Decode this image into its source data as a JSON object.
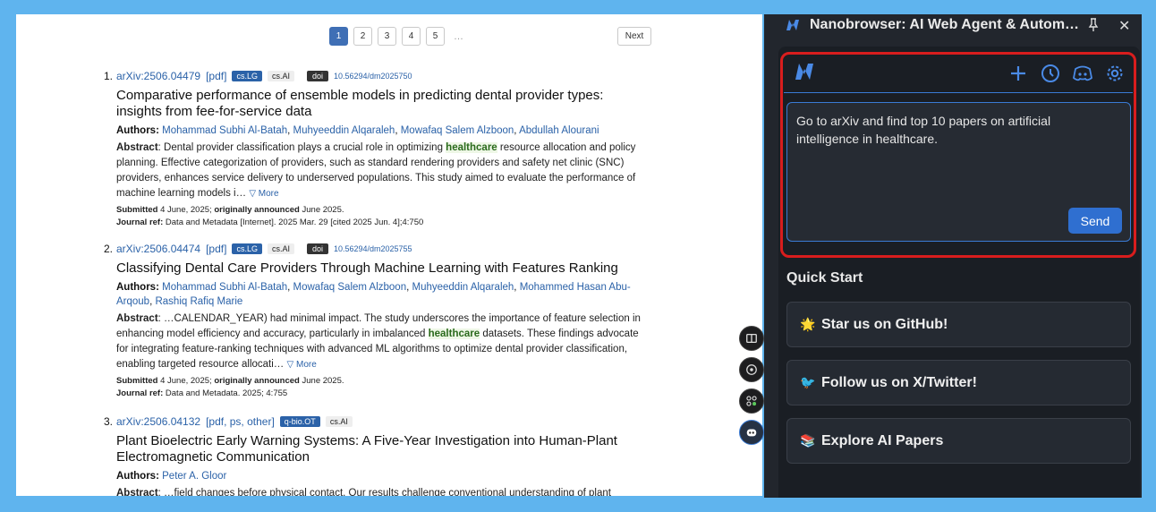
{
  "pagination": {
    "pages": [
      "1",
      "2",
      "3",
      "4",
      "5"
    ],
    "ellipsis": "…",
    "next": "Next"
  },
  "results": [
    {
      "num": "1.",
      "id": "arXiv:2506.04479",
      "formats": "[pdf]",
      "primary": "cs.LG",
      "secondary": "cs.AI",
      "doi_label": "doi",
      "doi": "10.56294/dm2025750",
      "title_l1": "Comparative performance of ensemble models in predicting dental provider types:",
      "title_l2": "insights from fee-for-service data",
      "authors_label": "Authors:",
      "authors": [
        "Mohammad Subhi Al-Batah",
        "Muhyeeddin Alqaraleh",
        "Mowafaq Salem Alzboon",
        "Abdullah Alourani"
      ],
      "abs_label": "Abstract",
      "abs_pre": ": Dental provider classification plays a crucial role in optimizing ",
      "abs_hl": "healthcare",
      "abs_post": " resource allocation and policy planning. Effective categorization of providers, such as standard rendering providers and safety net clinic (SNC) providers, enhances service delivery to underserved populations. This study aimed to evaluate the performance of machine learning models i…",
      "more": "▽ More",
      "submitted_label": "Submitted",
      "submitted": " 4 June, 2025; ",
      "announced_label": "originally announced",
      "announced": " June 2025.",
      "journal_label": "Journal ref:",
      "journal": " Data and Metadata [Internet]. 2025 Mar. 29 [cited 2025 Jun. 4];4:750"
    },
    {
      "num": "2.",
      "id": "arXiv:2506.04474",
      "formats": "[pdf]",
      "primary": "cs.LG",
      "secondary": "cs.AI",
      "doi_label": "doi",
      "doi": "10.56294/dm2025755",
      "title_l1": "Classifying Dental Care Providers Through Machine Learning with Features Ranking",
      "authors_label": "Authors:",
      "authors": [
        "Mohammad Subhi Al-Batah",
        "Mowafaq Salem Alzboon",
        "Muhyeeddin Alqaraleh",
        "Mohammed Hasan Abu-Arqoub",
        "Rashiq Rafiq Marie"
      ],
      "abs_label": "Abstract",
      "abs_pre": ": …CALENDAR_YEAR) had minimal impact. The study underscores the importance of feature selection in enhancing model efficiency and accuracy, particularly in imbalanced ",
      "abs_hl": "healthcare",
      "abs_post": " datasets. These findings advocate for integrating feature-ranking techniques with advanced ML algorithms to optimize dental provider classification, enabling targeted resource allocati…",
      "more": "▽ More",
      "submitted_label": "Submitted",
      "submitted": " 4 June, 2025; ",
      "announced_label": "originally announced",
      "announced": " June 2025.",
      "journal_label": "Journal ref:",
      "journal": " Data and Metadata. 2025; 4:755"
    },
    {
      "num": "3.",
      "id": "arXiv:2506.04132",
      "formats": "[pdf, ps, other]",
      "primary": "q-bio.OT",
      "secondary": "cs.AI",
      "title_l1": "Plant Bioelectric Early Warning Systems: A Five-Year Investigation into Human-Plant",
      "title_l2": "Electromagnetic Communication",
      "authors_label": "Authors:",
      "authors": [
        "Peter A. Gloor"
      ],
      "abs_label": "Abstract",
      "abs_pre": ": …field changes before physical contact. Our results challenge conventional understanding of plant"
    }
  ],
  "panel": {
    "title": "Nanobrowser: AI Web Agent & Autom…",
    "prompt": "Go to arXiv and find top 10 papers on artificial intelligence in healthcare.",
    "send": "Send",
    "quick_start": "Quick Start",
    "cards": [
      {
        "emoji": "🌟",
        "label": "Star us on GitHub!"
      },
      {
        "emoji": "🐦",
        "label": "Follow us on X/Twitter!"
      },
      {
        "emoji": "📚",
        "label": "Explore AI Papers"
      }
    ]
  },
  "colors": {
    "accent": "#2f6fd0",
    "highlight_box": "#d81d1d",
    "link": "#2b62a8"
  }
}
